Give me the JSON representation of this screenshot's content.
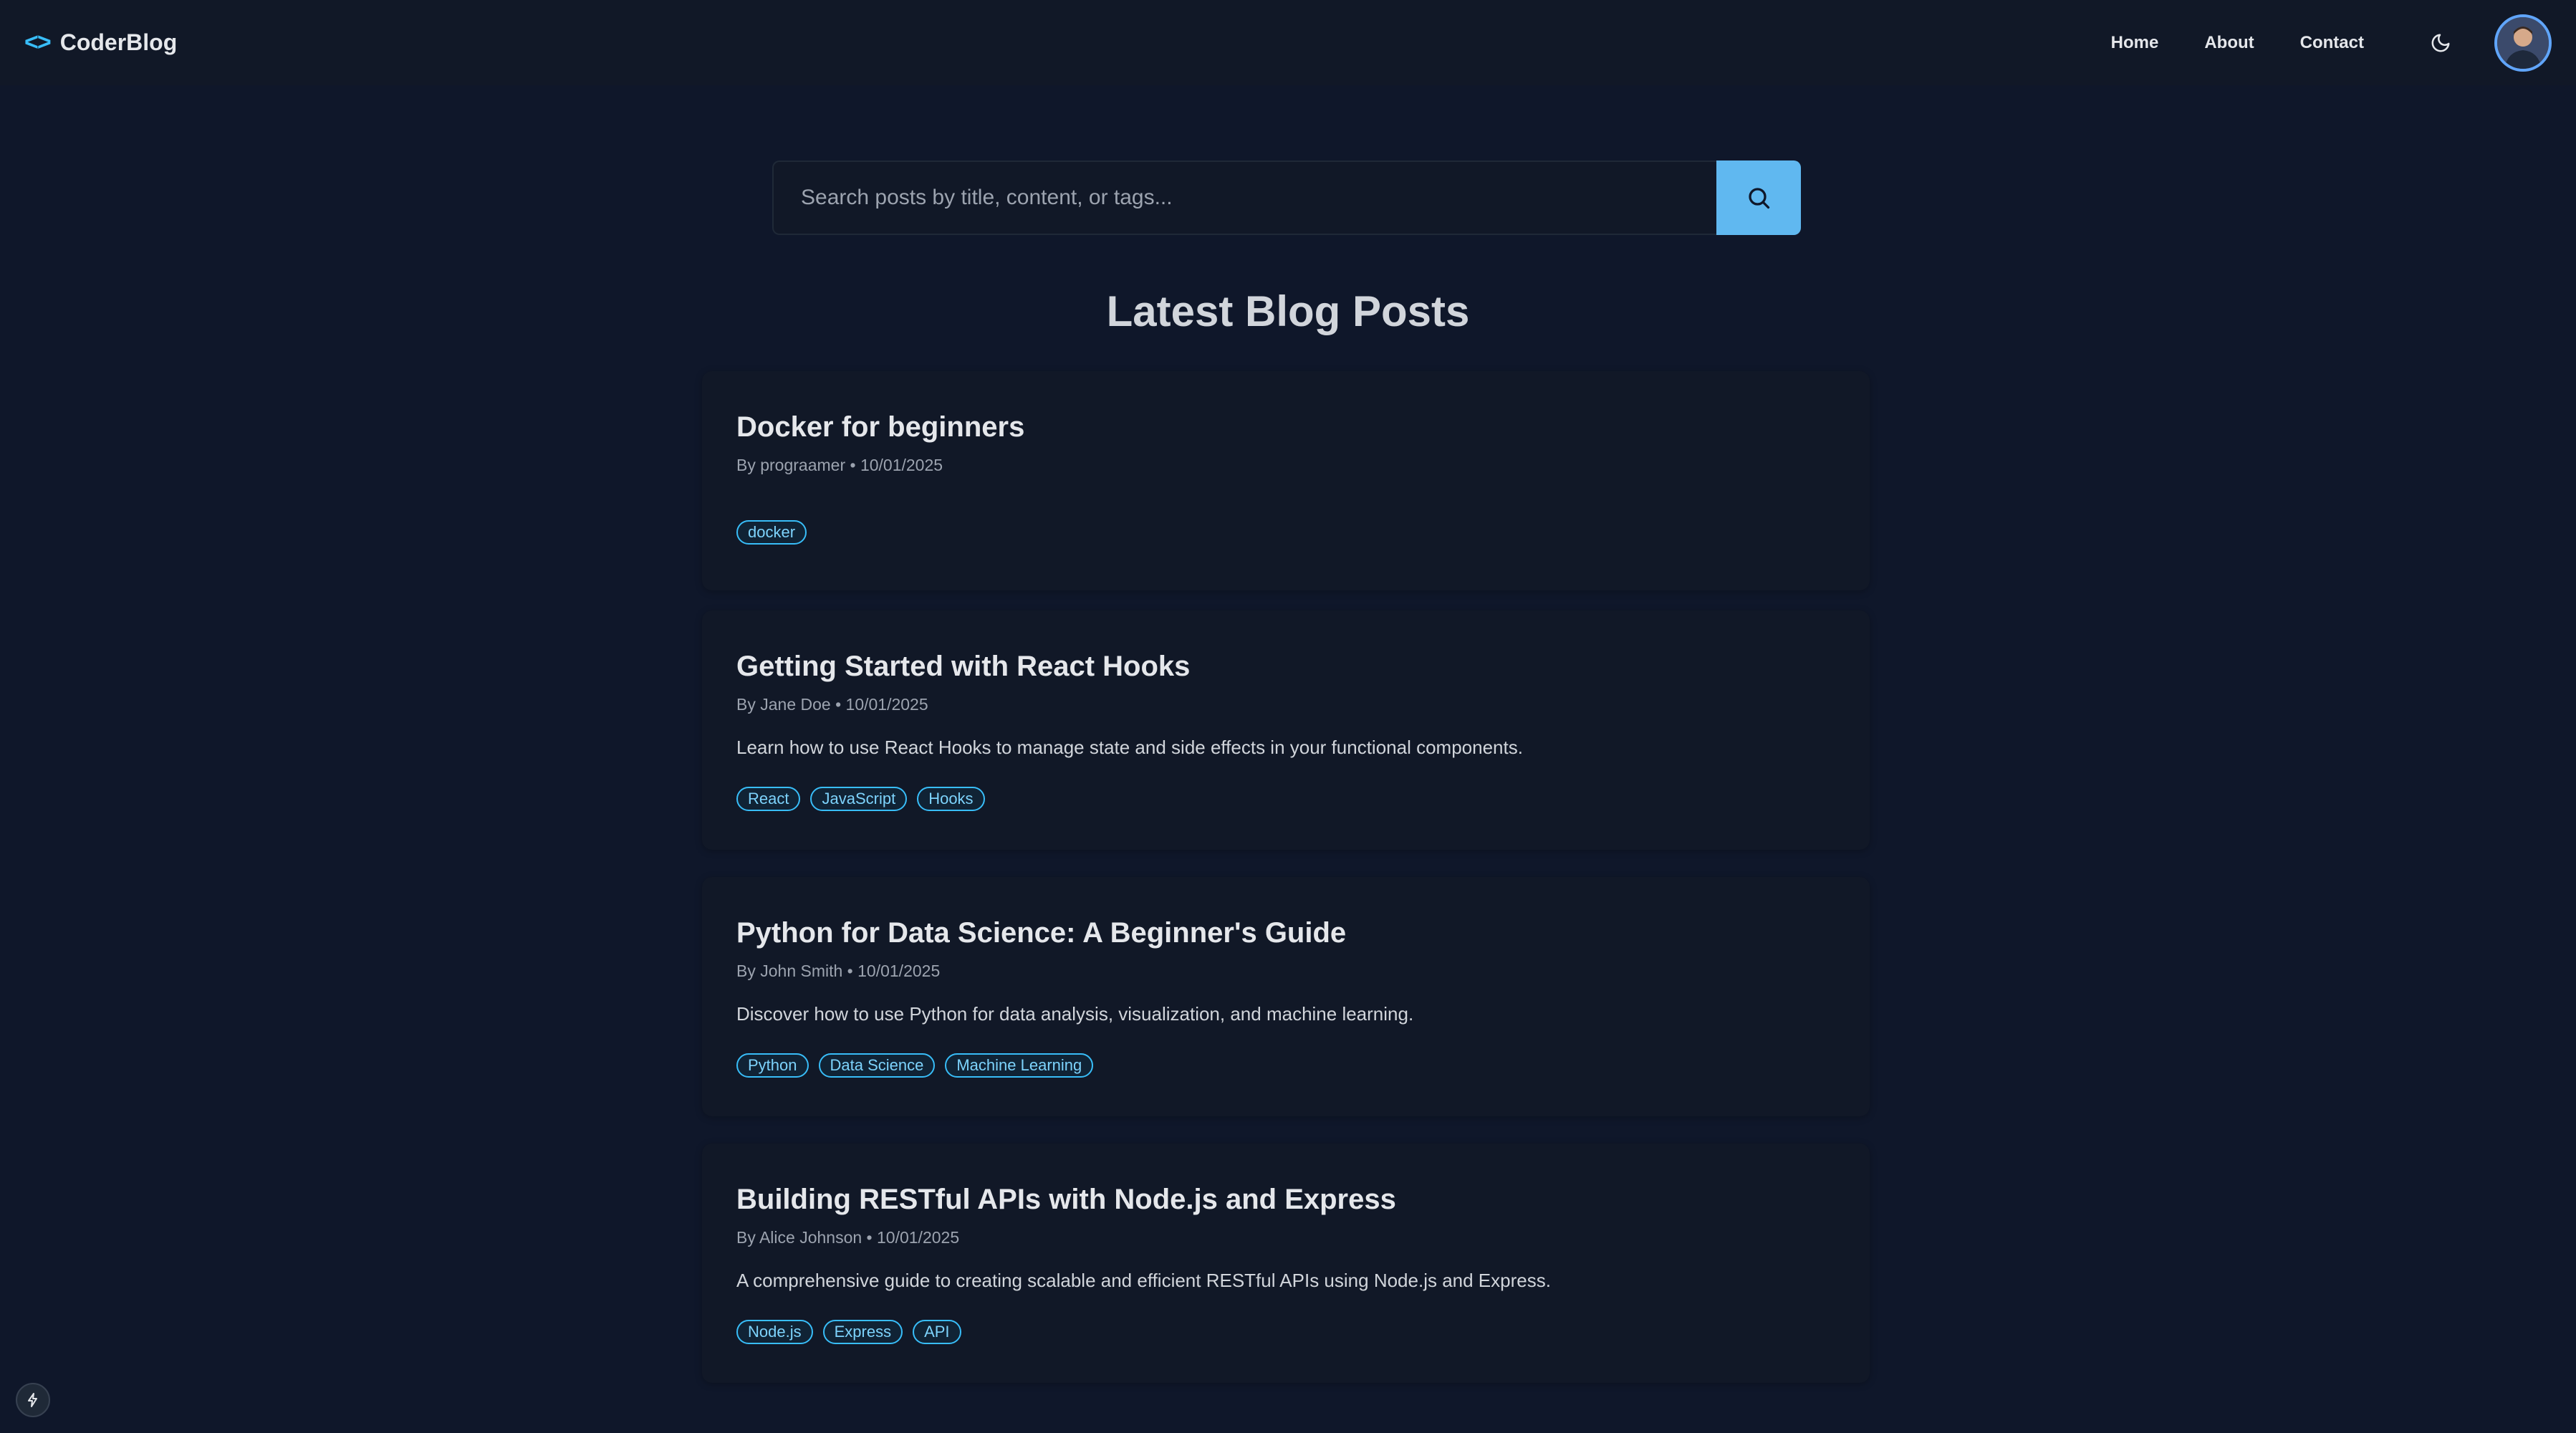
{
  "nav": {
    "brand_icon": "<>",
    "brand_name": "CoderBlog",
    "links": [
      "Home",
      "About",
      "Contact"
    ],
    "theme_icon": "moon-icon"
  },
  "search": {
    "placeholder": "Search posts by title, content, or tags...",
    "value": ""
  },
  "page_title": "Latest Blog Posts",
  "posts": [
    {
      "title": "Docker for beginners",
      "meta": "By prograamer • 10/01/2025",
      "excerpt": "",
      "tags": [
        "docker"
      ]
    },
    {
      "title": "Getting Started with React Hooks",
      "meta": "By Jane Doe • 10/01/2025",
      "excerpt": "Learn how to use React Hooks to manage state and side effects in your functional components.",
      "tags": [
        "React",
        "JavaScript",
        "Hooks"
      ]
    },
    {
      "title": "Python for Data Science: A Beginner's Guide",
      "meta": "By John Smith • 10/01/2025",
      "excerpt": "Discover how to use Python for data analysis, visualization, and machine learning.",
      "tags": [
        "Python",
        "Data Science",
        "Machine Learning"
      ]
    },
    {
      "title": "Building RESTful APIs with Node.js and Express",
      "meta": "By Alice Johnson • 10/01/2025",
      "excerpt": "A comprehensive guide to creating scalable and efficient RESTful APIs using Node.js and Express.",
      "tags": [
        "Node.js",
        "Express",
        "API"
      ]
    }
  ],
  "colors": {
    "background": "#0f172a",
    "card": "#111827",
    "accent": "#38bdf8",
    "search_button": "#60b8f0"
  }
}
